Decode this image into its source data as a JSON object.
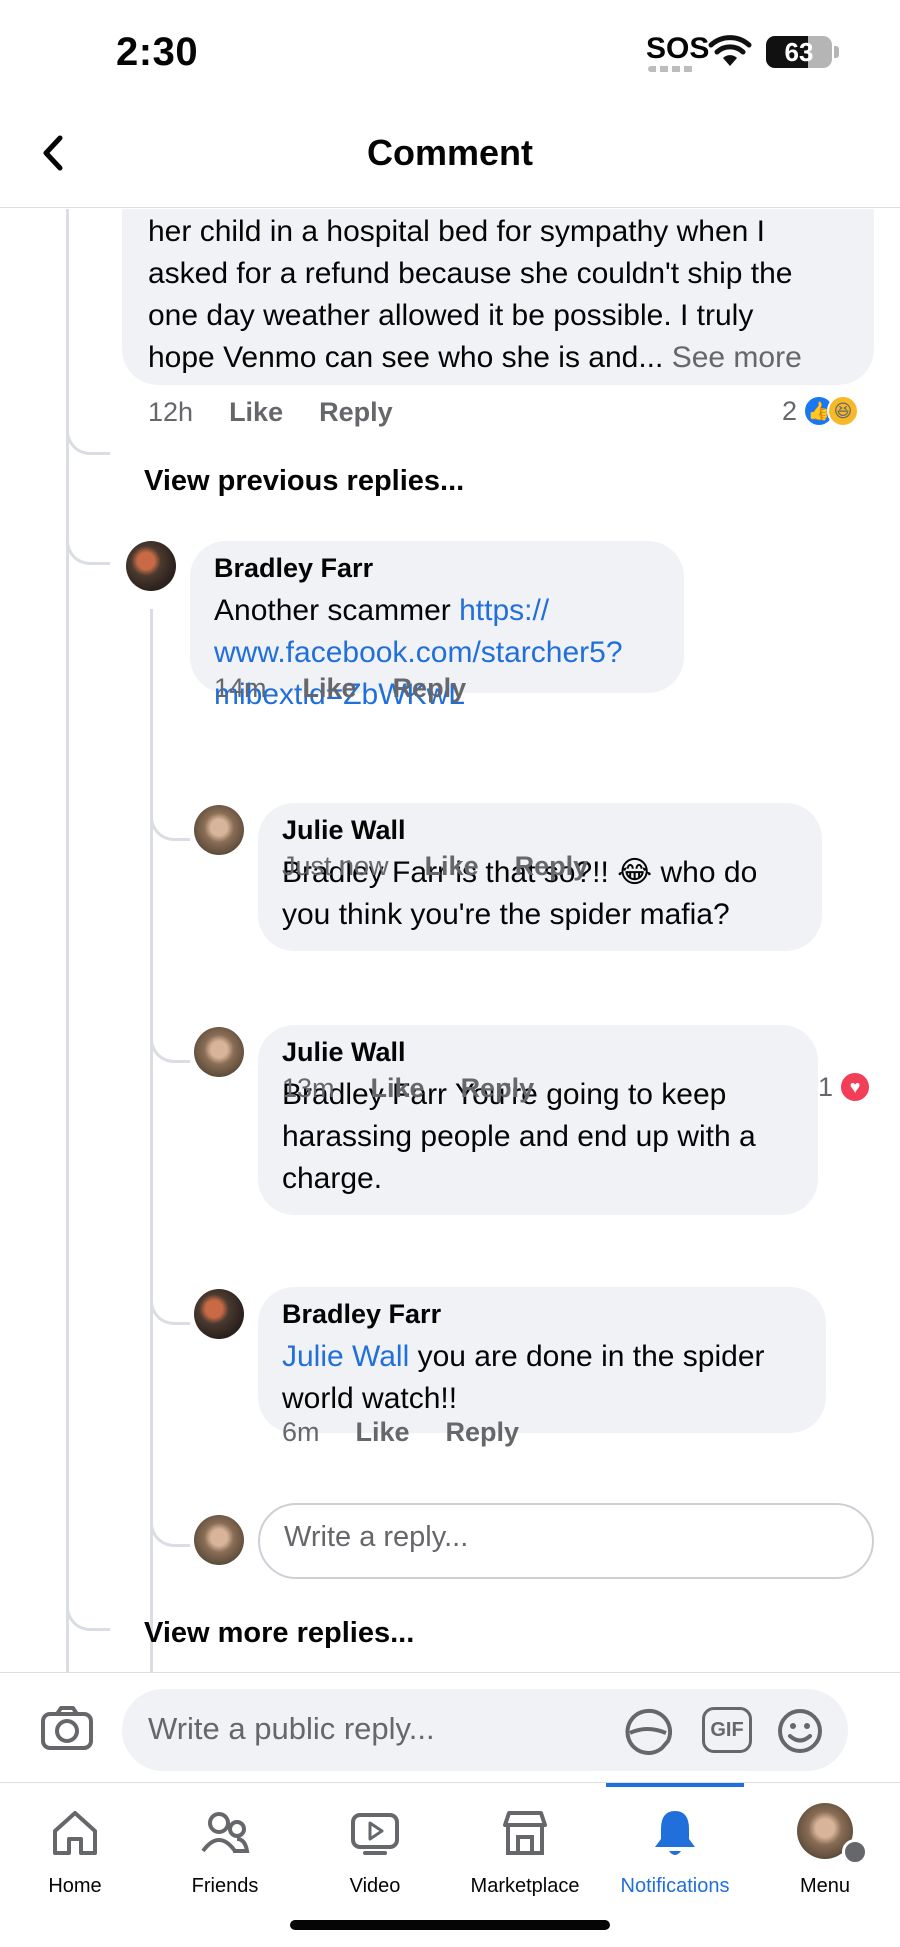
{
  "status_bar": {
    "time": "2:30",
    "sos": "SOS",
    "battery": "63",
    "battery_level": 0.63
  },
  "header": {
    "title": "Comment"
  },
  "top_comment": {
    "text_lines": [
      "her child in a hospital bed for sympathy when I",
      "asked for a refund because she couldn't ship the",
      "one day weather allowed it be possible. I truly",
      "hope Venmo can see who she is and..."
    ],
    "see_more": "See more",
    "time": "12h",
    "like": "Like",
    "reply": "Reply",
    "reaction_count": "2"
  },
  "view_previous": "View previous replies...",
  "replies": [
    {
      "author": "Bradley Farr",
      "text": "Another scammer ",
      "link": "https://www.facebook.com/starcher5?mibextid=ZbWKwL",
      "link_lines": [
        "https://",
        "www.facebook.com/starcher5?",
        "mibextid=ZbWKwL"
      ],
      "time": "14m",
      "like": "Like",
      "reply": "Reply"
    },
    {
      "author": "Julie Wall",
      "text_lines": [
        "Bradley Farr is that so?!! 😂 who do",
        "you think you're the spider mafia?"
      ],
      "time": "Just now",
      "like": "Like",
      "reply": "Reply"
    },
    {
      "author": "Julie Wall",
      "text_lines": [
        "Bradley Farr You're going to keep",
        "harassing people and end up with a",
        "charge."
      ],
      "time": "13m",
      "like": "Like",
      "reply": "Reply",
      "reaction_count": "1"
    },
    {
      "author": "Bradley Farr",
      "mention": "Julie Wall",
      "text_line1": " you are done in the spider",
      "text_line2": "world watch!!",
      "time": "6m",
      "like": "Like",
      "reply": "Reply"
    }
  ],
  "reply_input_placeholder": "Write a reply...",
  "view_more": "View more replies...",
  "composer": {
    "placeholder": "Write a public reply...",
    "gif": "GIF"
  },
  "nav": {
    "items": [
      {
        "label": "Home",
        "icon": "home-icon"
      },
      {
        "label": "Friends",
        "icon": "friends-icon"
      },
      {
        "label": "Video",
        "icon": "video-icon"
      },
      {
        "label": "Marketplace",
        "icon": "marketplace-icon"
      },
      {
        "label": "Notifications",
        "icon": "bell-icon",
        "active": true
      },
      {
        "label": "Menu",
        "icon": "avatar"
      }
    ]
  },
  "colors": {
    "accent": "#216fdb",
    "bubble": "#f0f2f5",
    "secondary_text": "#65676b"
  }
}
